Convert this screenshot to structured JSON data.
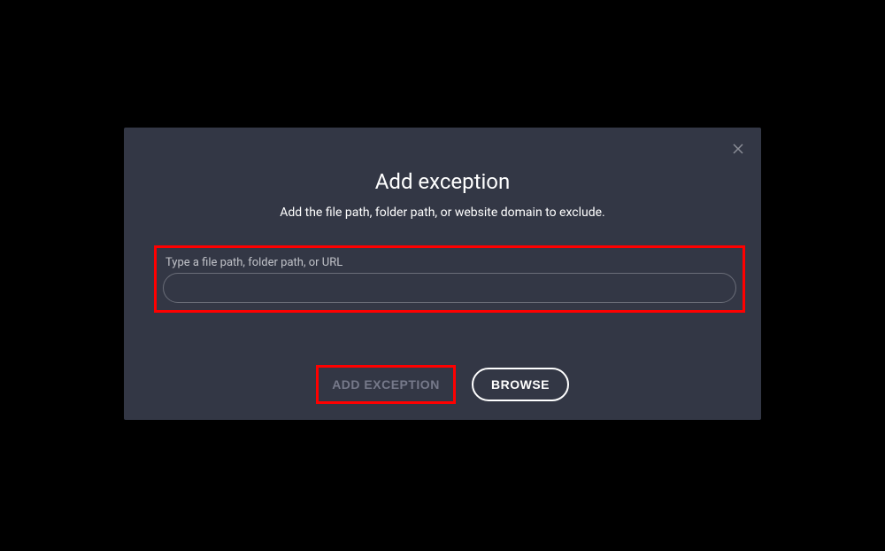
{
  "dialog": {
    "title": "Add exception",
    "subtitle": "Add the file path, folder path, or website domain to exclude.",
    "input": {
      "label": "Type a file path, folder path, or URL",
      "value": ""
    },
    "buttons": {
      "add_exception": "ADD EXCEPTION",
      "browse": "BROWSE"
    }
  }
}
